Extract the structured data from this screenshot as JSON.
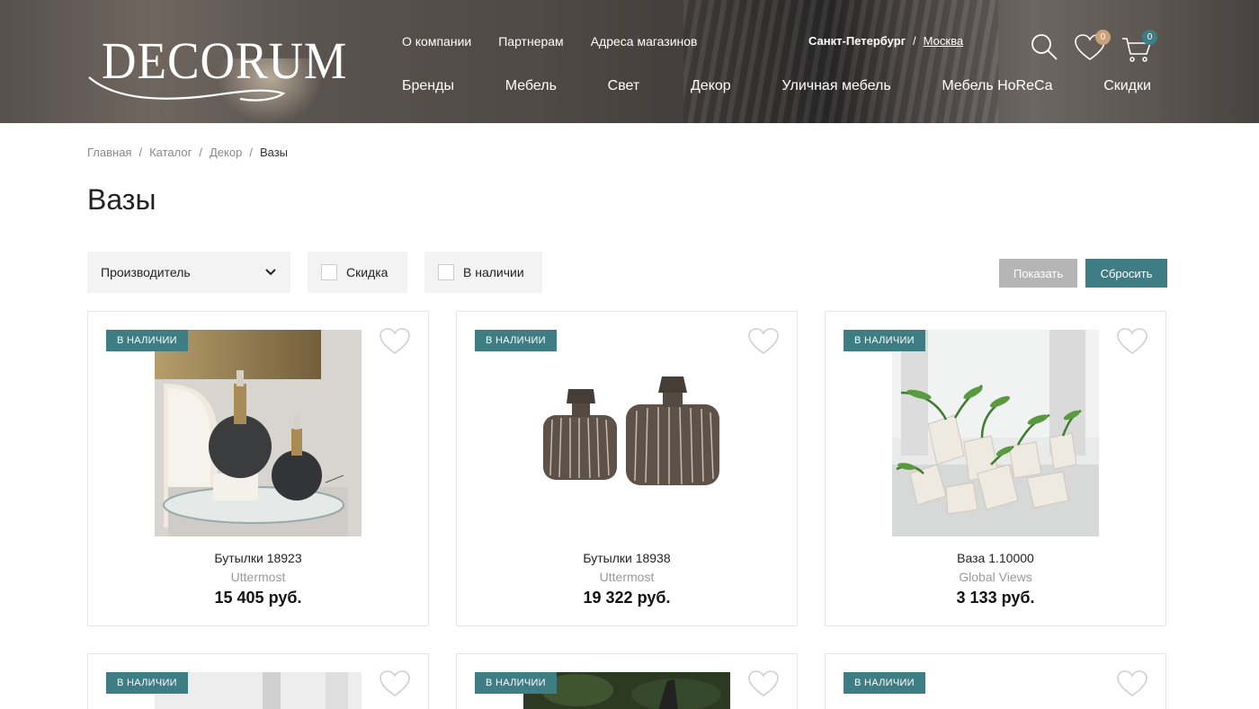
{
  "header": {
    "logo_text": "DECORUM",
    "top_links": [
      "О компании",
      "Партнерам",
      "Адреса магазинов"
    ],
    "city": {
      "current": "Санкт-Петербург",
      "separator": "/",
      "other": "Москва"
    },
    "main_nav": [
      "Бренды",
      "Мебель",
      "Свет",
      "Декор",
      "Уличная мебель",
      "Мебель HoReCa",
      "Скидки"
    ],
    "favorites_count": "0",
    "cart_count": "0",
    "icons": [
      "search-icon",
      "heart-icon",
      "cart-icon"
    ]
  },
  "breadcrumb": [
    "Главная",
    "Каталог",
    "Декор",
    "Вазы"
  ],
  "breadcrumb_sep": "/",
  "page_title": "Вазы",
  "filters": {
    "manufacturer_label": "Производитель",
    "discount_label": "Скидка",
    "in_stock_label": "В наличии",
    "show_button": "Показать",
    "reset_button": "Сбросить"
  },
  "products": [
    {
      "badge": "В НАЛИЧИИ",
      "name": "Бутылки 18923",
      "brand": "Uttermost",
      "price": "15 405 руб."
    },
    {
      "badge": "В НАЛИЧИИ",
      "name": "Бутылки 18938",
      "brand": "Uttermost",
      "price": "19 322 руб."
    },
    {
      "badge": "В НАЛИЧИИ",
      "name": "Ваза 1.10000",
      "brand": "Global Views",
      "price": "3 133 руб."
    },
    {
      "badge": "В НАЛИЧИИ"
    },
    {
      "badge": "В НАЛИЧИИ"
    },
    {
      "badge": "В НАЛИЧИИ"
    }
  ],
  "colors": {
    "accent": "#3f7d84",
    "muted_button": "#b5b5b5",
    "filter_bg": "#f3f3f3",
    "badge_orange": "#c9a27a"
  }
}
